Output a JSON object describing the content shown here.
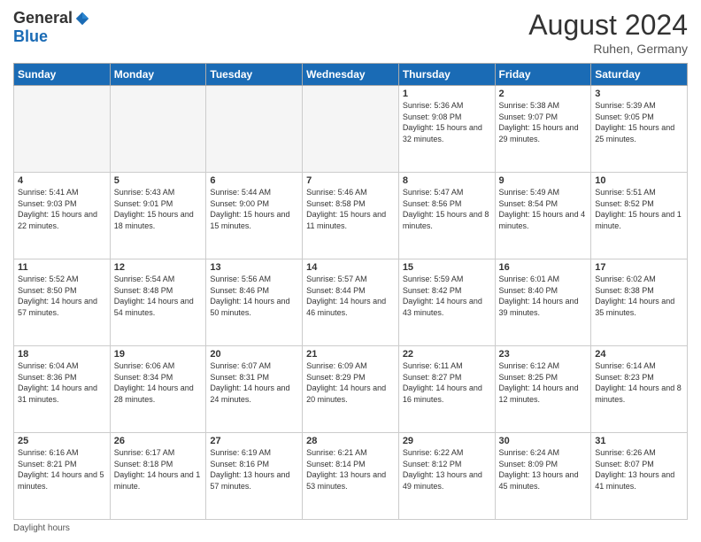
{
  "logo": {
    "general": "General",
    "blue": "Blue"
  },
  "header": {
    "month": "August 2024",
    "location": "Ruhen, Germany"
  },
  "days_of_week": [
    "Sunday",
    "Monday",
    "Tuesday",
    "Wednesday",
    "Thursday",
    "Friday",
    "Saturday"
  ],
  "weeks": [
    [
      {
        "day": "",
        "info": ""
      },
      {
        "day": "",
        "info": ""
      },
      {
        "day": "",
        "info": ""
      },
      {
        "day": "",
        "info": ""
      },
      {
        "day": "1",
        "info": "Sunrise: 5:36 AM\nSunset: 9:08 PM\nDaylight: 15 hours and 32 minutes."
      },
      {
        "day": "2",
        "info": "Sunrise: 5:38 AM\nSunset: 9:07 PM\nDaylight: 15 hours and 29 minutes."
      },
      {
        "day": "3",
        "info": "Sunrise: 5:39 AM\nSunset: 9:05 PM\nDaylight: 15 hours and 25 minutes."
      }
    ],
    [
      {
        "day": "4",
        "info": "Sunrise: 5:41 AM\nSunset: 9:03 PM\nDaylight: 15 hours and 22 minutes."
      },
      {
        "day": "5",
        "info": "Sunrise: 5:43 AM\nSunset: 9:01 PM\nDaylight: 15 hours and 18 minutes."
      },
      {
        "day": "6",
        "info": "Sunrise: 5:44 AM\nSunset: 9:00 PM\nDaylight: 15 hours and 15 minutes."
      },
      {
        "day": "7",
        "info": "Sunrise: 5:46 AM\nSunset: 8:58 PM\nDaylight: 15 hours and 11 minutes."
      },
      {
        "day": "8",
        "info": "Sunrise: 5:47 AM\nSunset: 8:56 PM\nDaylight: 15 hours and 8 minutes."
      },
      {
        "day": "9",
        "info": "Sunrise: 5:49 AM\nSunset: 8:54 PM\nDaylight: 15 hours and 4 minutes."
      },
      {
        "day": "10",
        "info": "Sunrise: 5:51 AM\nSunset: 8:52 PM\nDaylight: 15 hours and 1 minute."
      }
    ],
    [
      {
        "day": "11",
        "info": "Sunrise: 5:52 AM\nSunset: 8:50 PM\nDaylight: 14 hours and 57 minutes."
      },
      {
        "day": "12",
        "info": "Sunrise: 5:54 AM\nSunset: 8:48 PM\nDaylight: 14 hours and 54 minutes."
      },
      {
        "day": "13",
        "info": "Sunrise: 5:56 AM\nSunset: 8:46 PM\nDaylight: 14 hours and 50 minutes."
      },
      {
        "day": "14",
        "info": "Sunrise: 5:57 AM\nSunset: 8:44 PM\nDaylight: 14 hours and 46 minutes."
      },
      {
        "day": "15",
        "info": "Sunrise: 5:59 AM\nSunset: 8:42 PM\nDaylight: 14 hours and 43 minutes."
      },
      {
        "day": "16",
        "info": "Sunrise: 6:01 AM\nSunset: 8:40 PM\nDaylight: 14 hours and 39 minutes."
      },
      {
        "day": "17",
        "info": "Sunrise: 6:02 AM\nSunset: 8:38 PM\nDaylight: 14 hours and 35 minutes."
      }
    ],
    [
      {
        "day": "18",
        "info": "Sunrise: 6:04 AM\nSunset: 8:36 PM\nDaylight: 14 hours and 31 minutes."
      },
      {
        "day": "19",
        "info": "Sunrise: 6:06 AM\nSunset: 8:34 PM\nDaylight: 14 hours and 28 minutes."
      },
      {
        "day": "20",
        "info": "Sunrise: 6:07 AM\nSunset: 8:31 PM\nDaylight: 14 hours and 24 minutes."
      },
      {
        "day": "21",
        "info": "Sunrise: 6:09 AM\nSunset: 8:29 PM\nDaylight: 14 hours and 20 minutes."
      },
      {
        "day": "22",
        "info": "Sunrise: 6:11 AM\nSunset: 8:27 PM\nDaylight: 14 hours and 16 minutes."
      },
      {
        "day": "23",
        "info": "Sunrise: 6:12 AM\nSunset: 8:25 PM\nDaylight: 14 hours and 12 minutes."
      },
      {
        "day": "24",
        "info": "Sunrise: 6:14 AM\nSunset: 8:23 PM\nDaylight: 14 hours and 8 minutes."
      }
    ],
    [
      {
        "day": "25",
        "info": "Sunrise: 6:16 AM\nSunset: 8:21 PM\nDaylight: 14 hours and 5 minutes."
      },
      {
        "day": "26",
        "info": "Sunrise: 6:17 AM\nSunset: 8:18 PM\nDaylight: 14 hours and 1 minute."
      },
      {
        "day": "27",
        "info": "Sunrise: 6:19 AM\nSunset: 8:16 PM\nDaylight: 13 hours and 57 minutes."
      },
      {
        "day": "28",
        "info": "Sunrise: 6:21 AM\nSunset: 8:14 PM\nDaylight: 13 hours and 53 minutes."
      },
      {
        "day": "29",
        "info": "Sunrise: 6:22 AM\nSunset: 8:12 PM\nDaylight: 13 hours and 49 minutes."
      },
      {
        "day": "30",
        "info": "Sunrise: 6:24 AM\nSunset: 8:09 PM\nDaylight: 13 hours and 45 minutes."
      },
      {
        "day": "31",
        "info": "Sunrise: 6:26 AM\nSunset: 8:07 PM\nDaylight: 13 hours and 41 minutes."
      }
    ]
  ],
  "footer": {
    "daylight_label": "Daylight hours"
  }
}
